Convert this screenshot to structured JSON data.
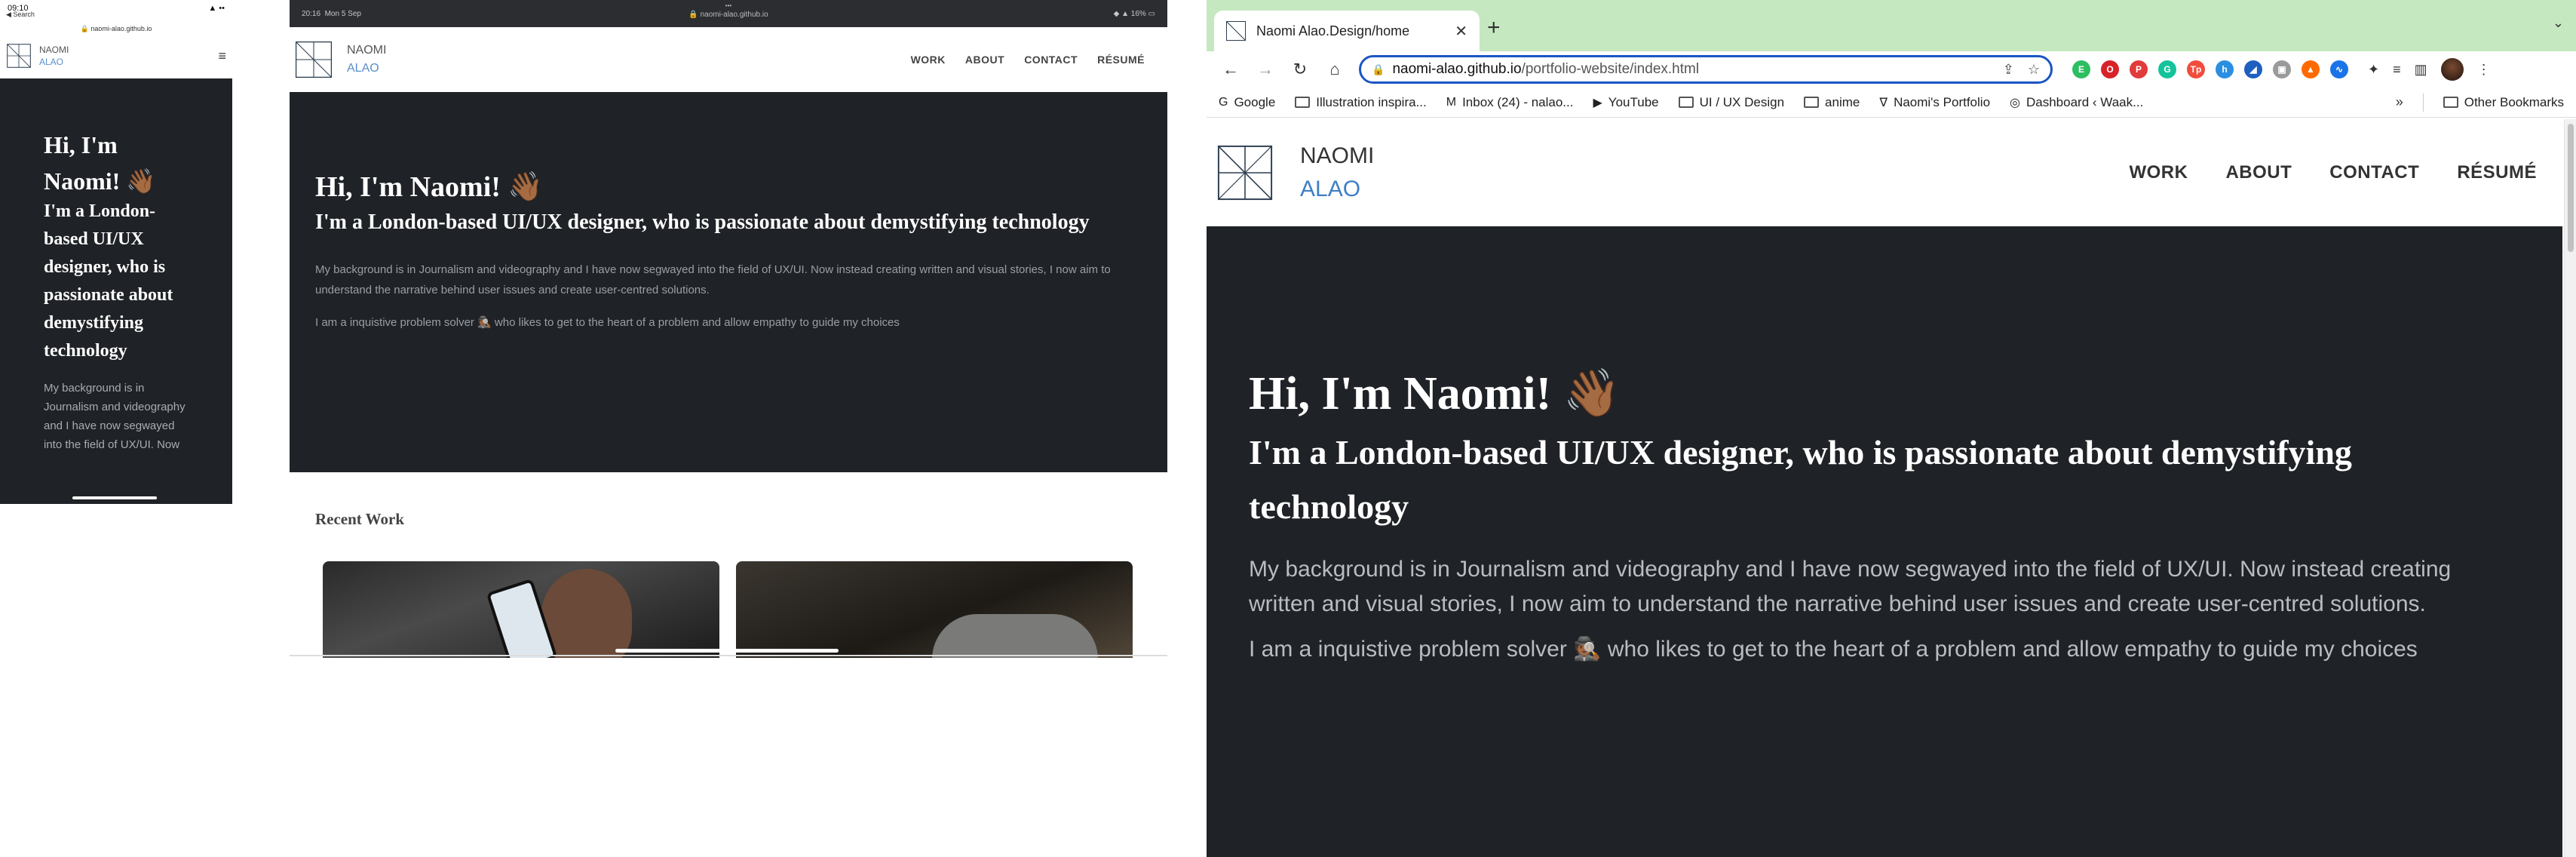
{
  "phone": {
    "time": "09:10",
    "signal": "▲ ••",
    "back_label": "◀ Search",
    "url": "🔒 naomi-alao.github.io",
    "brand_first": "NAOMI",
    "brand_last": "ALAO",
    "menu_icon": "≡",
    "hero": {
      "greeting": "Hi, I'm Naomi! 👋🏾",
      "tagline": "I'm a London-based UI/UX designer, who is passionate about demystifying technology",
      "background": "My background is in Journalism and videography and I have now segwayed into the field of UX/UI. Now"
    }
  },
  "tablet": {
    "time": "20:16",
    "date": "Mon 5 Sep",
    "url": "🔒 naomi-alao.github.io",
    "dots": "•••",
    "status_right": "◆ ▲ 16% ▭",
    "brand_first": "NAOMI",
    "brand_last": "ALAO",
    "nav": [
      "WORK",
      "ABOUT",
      "CONTACT",
      "RÉSUMÉ"
    ],
    "hero": {
      "greeting": "Hi, I'm Naomi! 👋🏾",
      "tagline": "I'm a London-based UI/UX designer, who is passionate about demystifying technology",
      "background": "My background is in Journalism and videography and I have now segwayed into the field of UX/UI. Now instead creating written and visual stories, I now aim to understand the narrative behind user issues and create user-centred solutions.",
      "solver": "I am a inquistive problem solver 🕵🏾 who likes to get to the heart of a problem and allow empathy to guide my choices"
    },
    "recent_work_title": "Recent Work"
  },
  "browser": {
    "tab_title": "Naomi Alao.Design/home",
    "tab_close": "✕",
    "new_tab": "+",
    "tab_menu": "⌄",
    "back": "←",
    "forward": "→",
    "reload": "↻",
    "home": "⌂",
    "lock": "🔒",
    "url_host": "naomi-alao.github.io",
    "url_path": "/portfolio-website/index.html",
    "share_icon": "⇪",
    "star_icon": "☆",
    "extensions": [
      {
        "name": "evernote",
        "label": "E",
        "color": "#2dbe60"
      },
      {
        "name": "opera",
        "label": "O",
        "color": "#d8232a"
      },
      {
        "name": "pdf",
        "label": "P",
        "color": "#e23b3b"
      },
      {
        "name": "grammarly",
        "label": "G",
        "color": "#15c39a"
      },
      {
        "name": "tp",
        "label": "Tp",
        "color": "#f24c3d"
      },
      {
        "name": "h",
        "label": "h",
        "color": "#2a8fe0"
      },
      {
        "name": "megaphone",
        "label": "◢",
        "color": "#1f5fc1"
      },
      {
        "name": "gray",
        "label": "▣",
        "color": "#9a9a9a"
      },
      {
        "name": "fire",
        "label": "▲",
        "color": "#ff6a00"
      },
      {
        "name": "wave",
        "label": "∿",
        "color": "#1a73e8"
      }
    ],
    "puzzle_icon": "✦",
    "readinglist_icon": "≡",
    "sidepanel_icon": "▥",
    "kebab_icon": "⋮",
    "bookmarks": [
      {
        "label": "Google",
        "icon": "G",
        "kind": "site"
      },
      {
        "label": "Illustration inspira...",
        "icon": "",
        "kind": "folder"
      },
      {
        "label": "Inbox (24) - nalao...",
        "icon": "M",
        "kind": "site"
      },
      {
        "label": "YouTube",
        "icon": "▶",
        "kind": "site"
      },
      {
        "label": "UI / UX Design",
        "icon": "",
        "kind": "folder"
      },
      {
        "label": "anime",
        "icon": "",
        "kind": "folder"
      },
      {
        "label": "Naomi's Portfolio",
        "icon": "∇",
        "kind": "site"
      },
      {
        "label": "Dashboard ‹ Waak...",
        "icon": "◎",
        "kind": "site"
      }
    ],
    "bookmarks_more": "»",
    "other_bookmarks": "Other Bookmarks",
    "site": {
      "brand_first": "NAOMI",
      "brand_last": "ALAO",
      "nav": [
        "WORK",
        "ABOUT",
        "CONTACT",
        "RÉSUMÉ"
      ],
      "hero": {
        "greeting": "Hi, I'm Naomi! 👋🏾",
        "tagline": "I'm a London-based UI/UX designer, who is passionate about demystifying technology",
        "background": "My background is in Journalism and videography and I have now segwayed into the field of UX/UI. Now instead creating written and visual stories, I now aim to understand the narrative behind user issues and create user-centred solutions.",
        "solver": "I am a inquistive problem solver 🕵🏾 who likes to get to the heart of a problem and allow empathy to guide my choices"
      }
    }
  }
}
